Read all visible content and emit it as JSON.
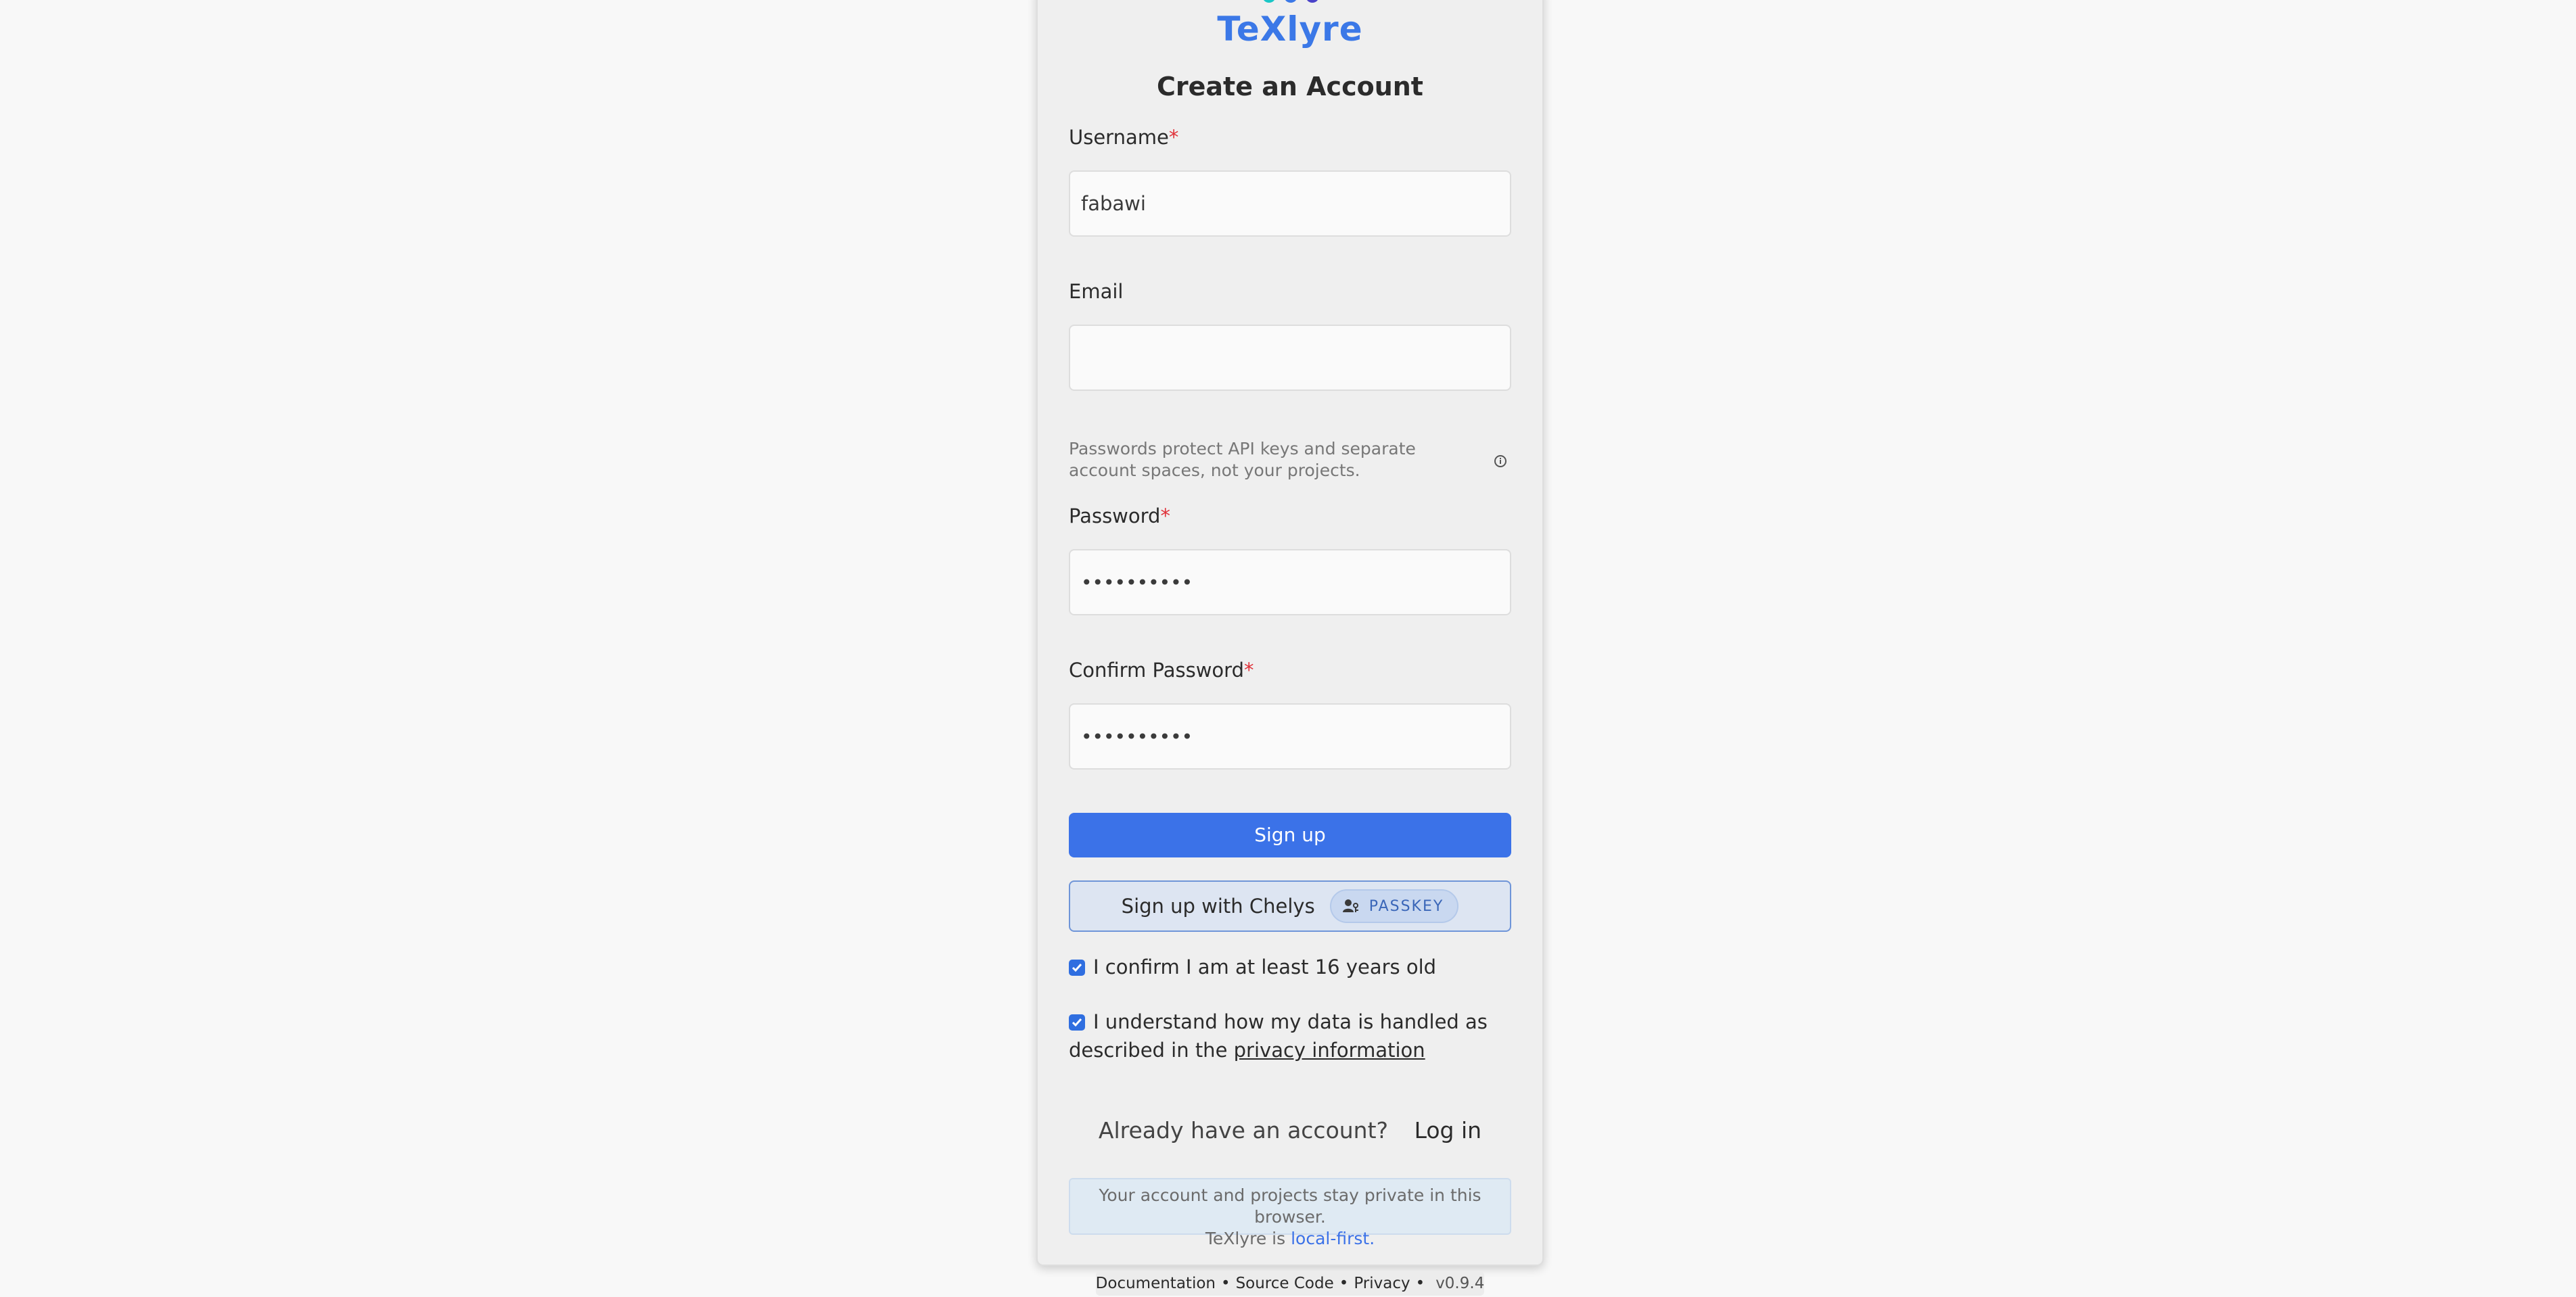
{
  "brand": {
    "name": "TeXlyre",
    "colors": [
      "#19c6c6",
      "#3b78e7",
      "#4a43c9"
    ]
  },
  "form": {
    "title": "Create an Account",
    "username": {
      "label": "Username",
      "required_mark": "*",
      "value": "fabawi"
    },
    "email": {
      "label": "Email",
      "value": "",
      "placeholder": ""
    },
    "password_hint": "Passwords protect API keys and separate account spaces, not your projects.",
    "password": {
      "label": "Password",
      "required_mark": "*",
      "value": "••••••••••"
    },
    "confirm_password": {
      "label": "Confirm Password",
      "required_mark": "*",
      "value": "••••••••••"
    },
    "signup_button": "Sign up",
    "chelys_button": {
      "label": "Sign up with Chelys",
      "badge": "PASSKEY",
      "badge_icon": "user-key-icon"
    },
    "age_check": {
      "checked": true,
      "label": "I confirm I am at least 16 years old"
    },
    "privacy_check": {
      "checked": true,
      "label_prefix": "I understand how my data is handled as described in the",
      "link": "privacy information"
    },
    "login_prompt": "Already have an account?",
    "login_link": "Log in",
    "notice_line1": "Your account and projects stay private in this browser.",
    "notice_prefix": "TeXlyre is",
    "notice_link": "local-first."
  },
  "footer": {
    "documentation": "Documentation",
    "source_code": "Source Code",
    "privacy": "Privacy",
    "separator": "•",
    "version": "v0.9.4"
  },
  "colors": {
    "primary": "#3b72e8",
    "required": "#e0323a",
    "background": "#f8f8f8",
    "card": "#efefef"
  }
}
